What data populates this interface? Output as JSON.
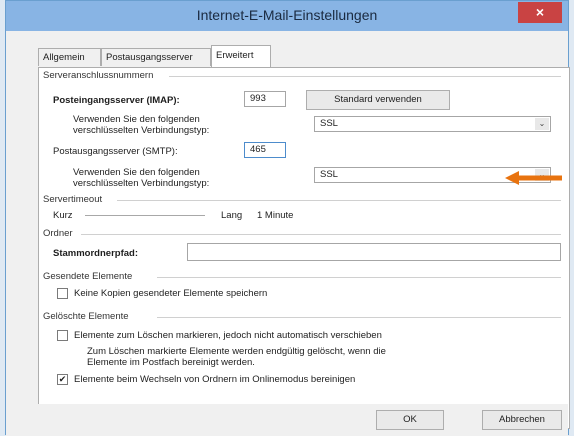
{
  "window": {
    "title": "Internet-E-Mail-Einstellungen",
    "close_glyph": "×"
  },
  "tabs": [
    {
      "label": "Allgemein",
      "active": false
    },
    {
      "label": "Postausgangsserver",
      "active": false
    },
    {
      "label": "Erweitert",
      "active": true
    }
  ],
  "server_ports": {
    "group_label": "Serveranschlussnummern",
    "incoming_label": "Posteingangsserver (IMAP):",
    "incoming_value": "993",
    "default_button": "Standard verwenden",
    "incoming_encryption_label_1": "Verwenden Sie den folgenden",
    "incoming_encryption_label_2": "verschlüsselten Verbindungstyp:",
    "incoming_encryption_value": "SSL",
    "outgoing_label": "Postausgangsserver (SMTP):",
    "outgoing_value": "465",
    "outgoing_encryption_label_1": "Verwenden Sie den folgenden",
    "outgoing_encryption_label_2": "verschlüsselten Verbindungstyp:",
    "outgoing_encryption_value": "SSL"
  },
  "timeout": {
    "group_label": "Servertimeout",
    "short_label": "Kurz",
    "long_label": "Lang",
    "value": "1 Minute"
  },
  "folders": {
    "group_label": "Ordner",
    "root_label": "Stammordnerpfad:",
    "root_value": ""
  },
  "sent_items": {
    "group_label": "Gesendete Elemente",
    "no_copies_label": "Keine Kopien gesendeter Elemente speichern",
    "no_copies_checked": false
  },
  "deleted_items": {
    "group_label": "Gelöschte Elemente",
    "mark_label": "Elemente zum Löschen markieren, jedoch nicht automatisch verschieben",
    "mark_checked": false,
    "info_line_1": "Zum Löschen markierte Elemente werden endgültig gelöscht, wenn die",
    "info_line_2": "Elemente im Postfach bereinigt werden.",
    "purge_label": "Elemente beim Wechseln von Ordnern im Onlinemodus bereinigen",
    "purge_checked": true,
    "check_glyph": "✔"
  },
  "footer": {
    "ok_label": "OK",
    "cancel_label": "Abbrechen"
  },
  "colors": {
    "annotation_arrow": "#e8730f",
    "titlebar": "#88b4e4",
    "close_button": "#c94343"
  },
  "combo_arrow_glyph": "⌄"
}
